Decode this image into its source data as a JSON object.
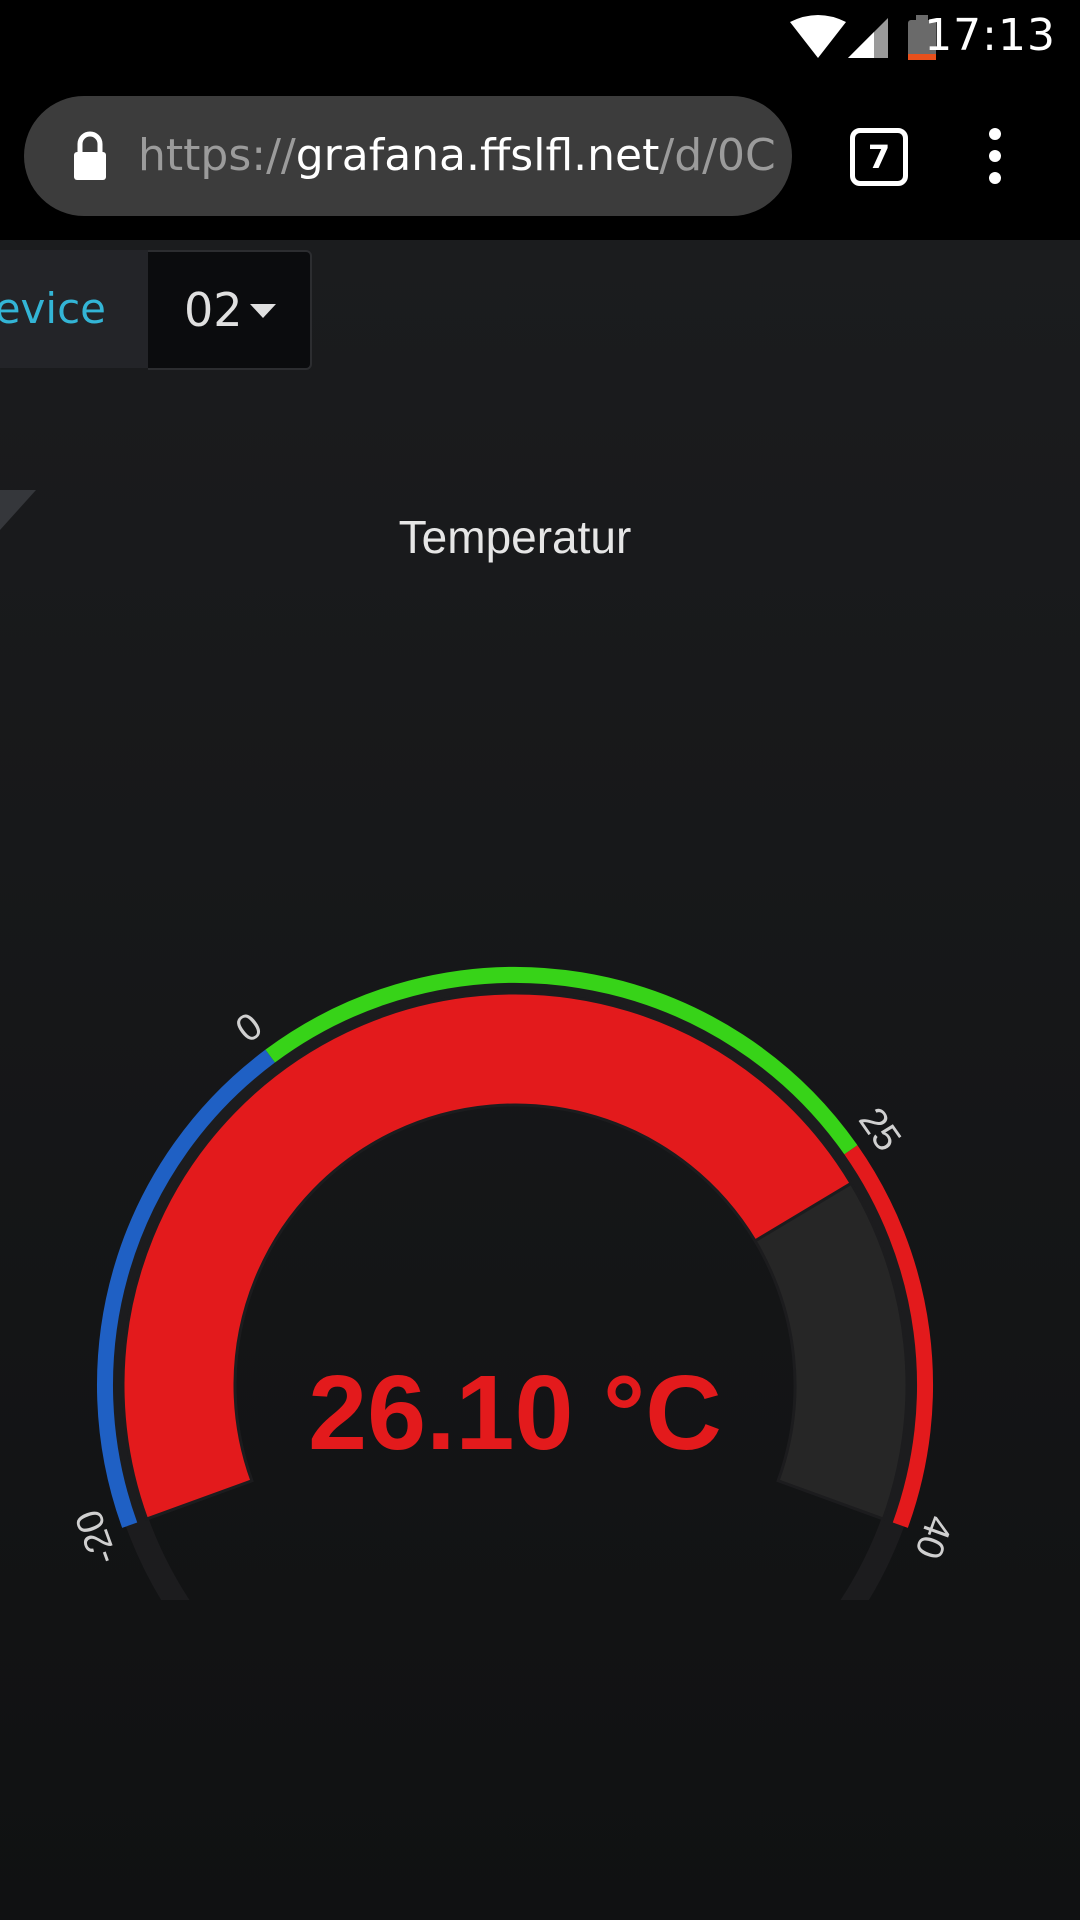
{
  "status_bar": {
    "time": "17:13",
    "icons": [
      "wifi-icon",
      "signal-icon",
      "battery-icon"
    ]
  },
  "browser": {
    "url_scheme": "https://",
    "url_host": "grafana.ffslfl.net",
    "url_path": "/d/0C",
    "tab_count": "7",
    "icons": [
      "lock-icon",
      "overflow-menu-icon"
    ]
  },
  "variable": {
    "label": "Device",
    "value": "02"
  },
  "panel": {
    "title": "Temperatur"
  },
  "gauge": {
    "value": 26.1,
    "value_text": "26.10 °C",
    "min": -20,
    "max": 40,
    "ticks": [
      "-20",
      "0",
      "25",
      "40"
    ],
    "thresholds": [
      {
        "from": -20,
        "to": 0,
        "color": "#1f60c4"
      },
      {
        "from": 0,
        "to": 25,
        "color": "#37d318"
      },
      {
        "from": 25,
        "to": 40,
        "color": "#e31a1c"
      }
    ],
    "value_color": "#e31a1c",
    "track_color": "#262626"
  }
}
